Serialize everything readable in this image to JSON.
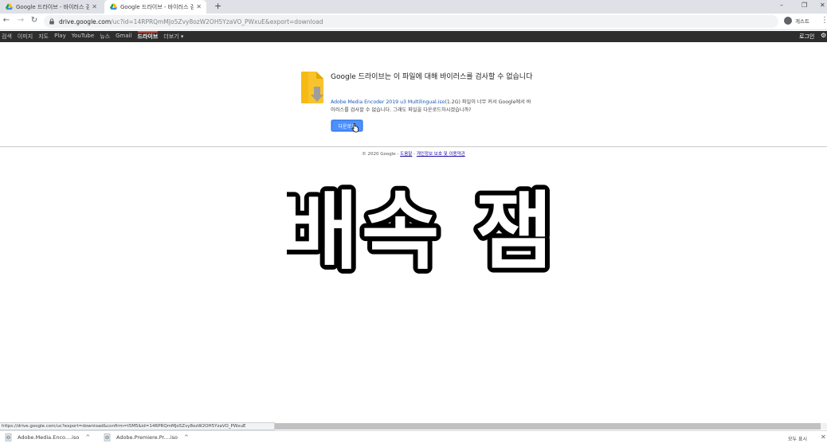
{
  "tabs": [
    {
      "title": "Google 드라이브 - 바이러스 검",
      "close": "✕"
    },
    {
      "title": "Google 드라이브 - 바이러스 검",
      "close": "✕"
    }
  ],
  "new_tab": "+",
  "window_controls": {
    "minimize": "–",
    "restore": "❐",
    "close": "✕"
  },
  "toolbar": {
    "back": "←",
    "forward": "→",
    "reload": "↻",
    "url_host": "drive.google.com",
    "url_rest": "/uc?id=14RPRQmMJo5Zvy8ozW2OH5YzaVO_PWxuE&export=download",
    "profile_label": "게스트",
    "menu": "⋮"
  },
  "gbar": {
    "links": [
      "검색",
      "이미지",
      "지도",
      "Play",
      "YouTube",
      "뉴스",
      "Gmail",
      "드라이브",
      "더보기 ▾"
    ],
    "selected_index": 7,
    "login": "로그인",
    "settings": "⚙"
  },
  "main": {
    "heading": "Google 드라이브는 이 파일에 대해 바이러스를 검사할 수 없습니다",
    "file_name": "Adobe Media Encoder 2019 u3 Multilingual.iso",
    "desc_rest": "(1.2G) 파일이 너무 커서 Google에서 바이러스를 검사할 수 없습니다. 그래도 파일을 다운로드하시겠습니까?",
    "download_button": "다운로드"
  },
  "footer": {
    "copyright": "© 2020 Google - ",
    "help": "도움말",
    "sep": " - ",
    "privacy": "개인정보 보호 및 이용약관"
  },
  "overlay_text": "배속 잼",
  "status_url": "https://drive.google.com/uc?export=download&confirm=t5M5&id=14RPRQmMJo5Zvy8ozW2OH5YzaVO_PWxuE",
  "downloads": {
    "items": [
      {
        "name": "Adobe.Media.Enco....iso",
        "caret": "^"
      },
      {
        "name": "Adobe.Premiere.Pr....iso",
        "caret": "^"
      }
    ],
    "show_all": "모두 표시",
    "close": "✕"
  },
  "colors": {
    "accent": "#4d90fe",
    "gbar": "#2d2d2d",
    "link": "#1a57b8"
  }
}
